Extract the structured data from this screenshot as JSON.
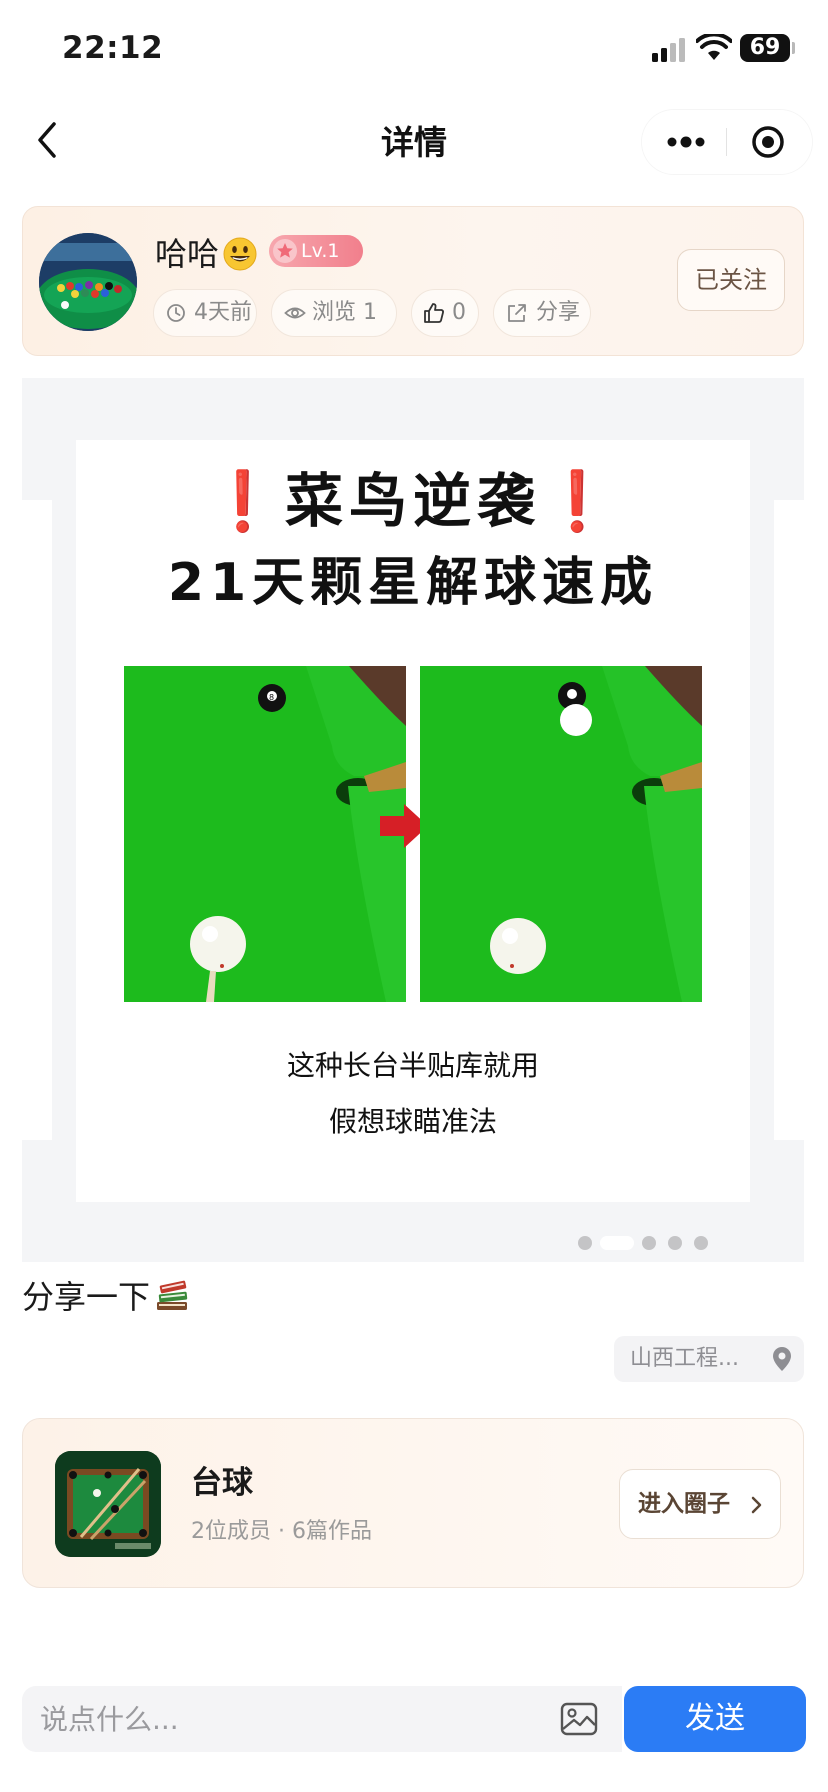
{
  "status_bar": {
    "time": "22:12",
    "battery": "69"
  },
  "nav": {
    "title": "详情"
  },
  "author": {
    "name": "哈哈",
    "level": "Lv.1",
    "time_ago": "4天前",
    "views": "浏览 1",
    "likes": "0",
    "share": "分享",
    "follow_label": "已关注"
  },
  "slide": {
    "title_line1": "菜鸟逆袭",
    "title_line2": "21天颗星解球速成",
    "caption_line1": "这种长台半贴库就用",
    "caption_line2": "假想球瞄准法",
    "total_dots": 5,
    "active_index": 1
  },
  "post": {
    "text": "分享一下",
    "location": "山西工程..."
  },
  "circle": {
    "name": "台球",
    "stats": "2位成员 · 6篇作品",
    "enter_label": "进入圈子"
  },
  "comment_bar": {
    "placeholder": "说点什么...",
    "send_label": "发送"
  },
  "colors": {
    "accent_blue": "#2b7cf5",
    "level_pink": "#f17f8c",
    "felt_green": "#1dbb1d",
    "alert_red": "#d61f26"
  }
}
